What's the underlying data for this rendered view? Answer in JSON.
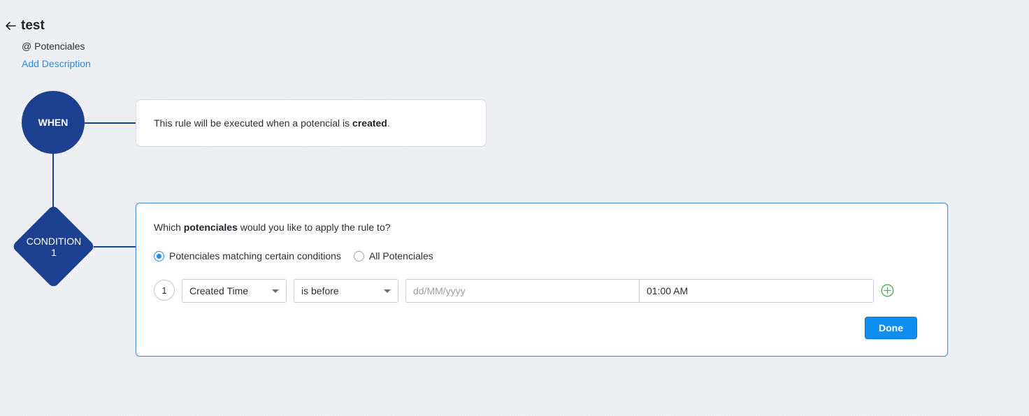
{
  "header": {
    "title": "test",
    "module": "@ Potenciales",
    "add_description": "Add Description"
  },
  "flow": {
    "when_node": "WHEN",
    "condition_node_line1": "CONDITION",
    "condition_node_line2": "1",
    "node_color": "#1d3f8f"
  },
  "when_card": {
    "text_before": "This rule will be executed when a potencial is ",
    "text_bold": "created",
    "text_after": "."
  },
  "condition_card": {
    "question_before": "Which ",
    "question_bold": "potenciales",
    "question_after": " would you like to apply the rule to?",
    "radio_options": [
      {
        "label": "Potenciales matching certain conditions",
        "selected": true
      },
      {
        "label": "All Potenciales",
        "selected": false
      }
    ],
    "criteria": {
      "number": "1",
      "field": "Created Time",
      "operator": "is before",
      "date_placeholder": "dd/MM/yyyy",
      "time_value": "01:00 AM"
    },
    "done_label": "Done"
  },
  "colors": {
    "accent": "#2a8ae0",
    "done_button": "#0e8ff0",
    "add_icon": "#4caf50"
  },
  "icons": {
    "back": "arrow-left-icon",
    "add": "plus-circle-icon",
    "dropdown": "caret-down-icon"
  }
}
